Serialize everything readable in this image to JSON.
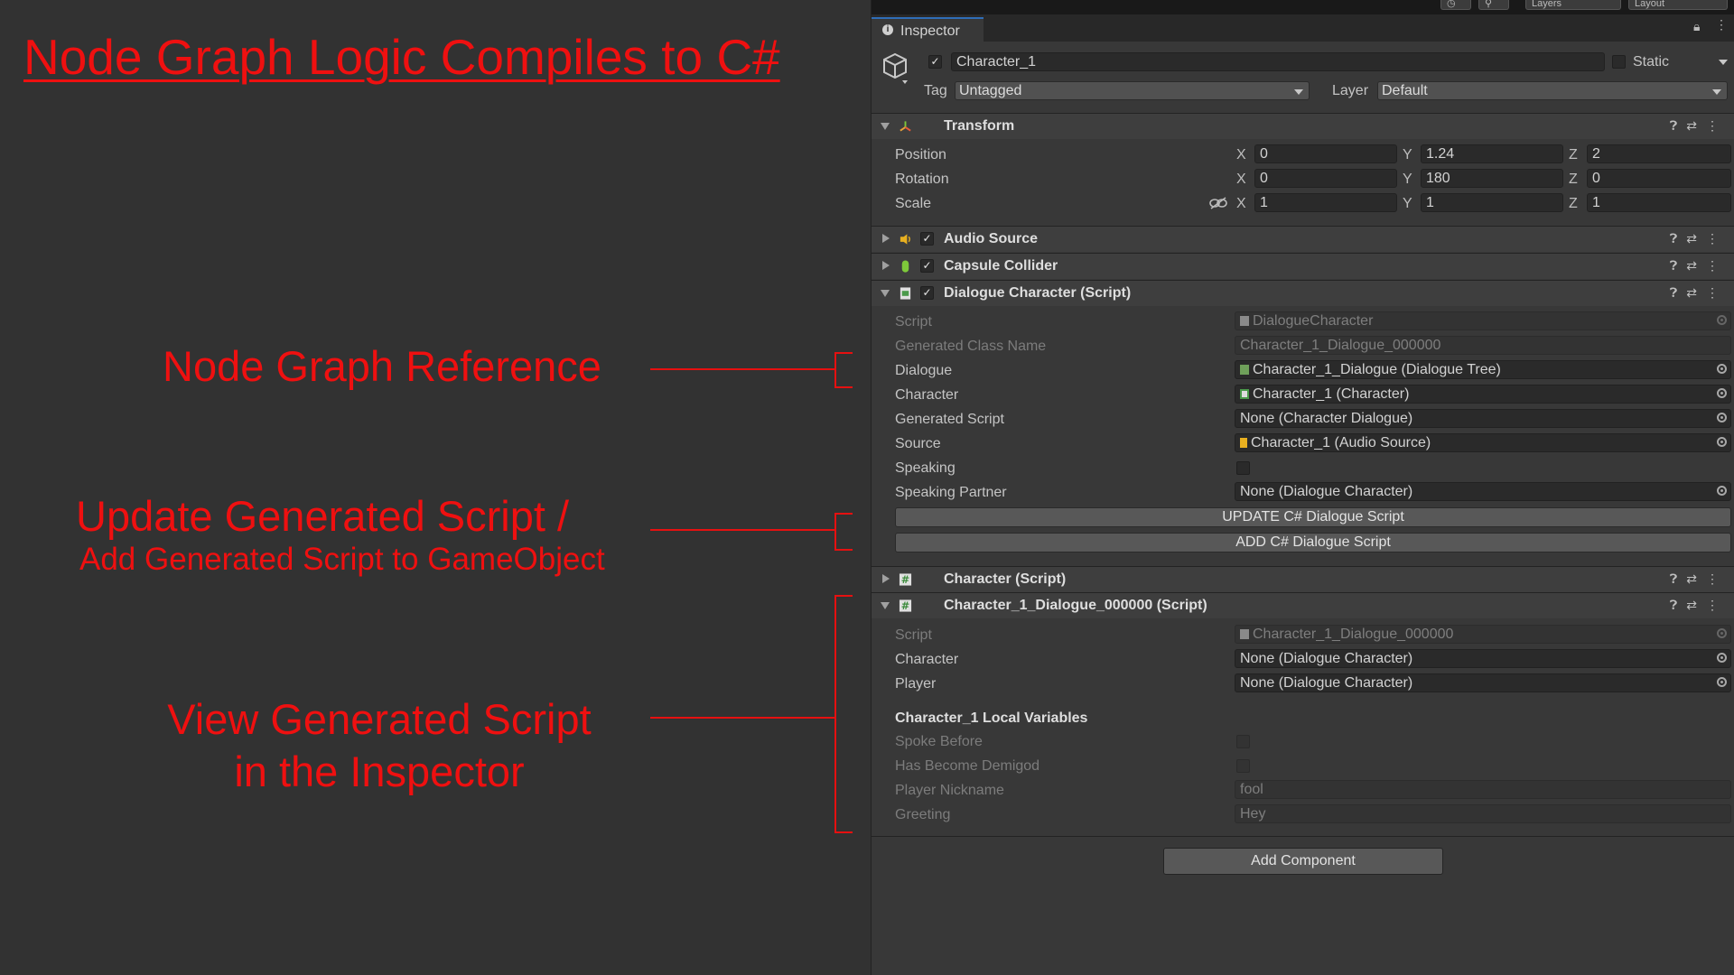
{
  "annotations": {
    "title": "Node Graph Logic Compiles to C#",
    "node_graph_reference": "Node Graph Reference",
    "update_generated_line1": "Update Generated Script /",
    "update_generated_line2": "Add Generated Script to GameObject",
    "view_generated_line1": "View Generated Script",
    "view_generated_line2": "in the Inspector"
  },
  "topbar": {
    "layers": "Layers",
    "layout": "Layout"
  },
  "inspector": {
    "tab_label": "Inspector",
    "object_name": "Character_1",
    "static_label": "Static",
    "tag_label": "Tag",
    "tag_value": "Untagged",
    "layer_label": "Layer",
    "layer_value": "Default"
  },
  "transform": {
    "title": "Transform",
    "axis": [
      "X",
      "Y",
      "Z"
    ],
    "rows": [
      {
        "label": "Position",
        "x": "0",
        "y": "1.24",
        "z": "2"
      },
      {
        "label": "Rotation",
        "x": "0",
        "y": "180",
        "z": "0"
      },
      {
        "label": "Scale",
        "x": "1",
        "y": "1",
        "z": "1"
      }
    ]
  },
  "components": {
    "audio_source": "Audio Source",
    "capsule_collider": "Capsule Collider",
    "dialogue_character": "Dialogue Character (Script)",
    "character_script": "Character (Script)",
    "generated_component": "Character_1_Dialogue_000000 (Script)"
  },
  "dialogue_character": {
    "script_label": "Script",
    "script_value": "DialogueCharacter",
    "class_label": "Generated Class Name",
    "class_value": "Character_1_Dialogue_000000",
    "dialogue_label": "Dialogue",
    "dialogue_value": "Character_1_Dialogue (Dialogue Tree)",
    "character_label": "Character",
    "character_value": "Character_1 (Character)",
    "generated_label": "Generated Script",
    "generated_value": "None (Character Dialogue)",
    "source_label": "Source",
    "source_value": "Character_1 (Audio Source)",
    "speaking_label": "Speaking",
    "partner_label": "Speaking Partner",
    "partner_value": "None (Dialogue Character)",
    "update_button": "UPDATE C# Dialogue Script",
    "add_button": "ADD C# Dialogue Script"
  },
  "generated": {
    "script_label": "Script",
    "script_value": "Character_1_Dialogue_000000",
    "character_label": "Character",
    "character_value": "None (Dialogue Character)",
    "player_label": "Player",
    "player_value": "None (Dialogue Character)",
    "locals_header": "Character_1 Local Variables",
    "spoke_label": "Spoke Before",
    "demigod_label": "Has Become Demigod",
    "nickname_label": "Player Nickname",
    "nickname_value": "fool",
    "greeting_label": "Greeting",
    "greeting_value": "Hey"
  },
  "add_component": "Add Component",
  "colors": {
    "annotation": "#ef1010",
    "panel_bg": "#383838",
    "left_bg": "#323232"
  }
}
